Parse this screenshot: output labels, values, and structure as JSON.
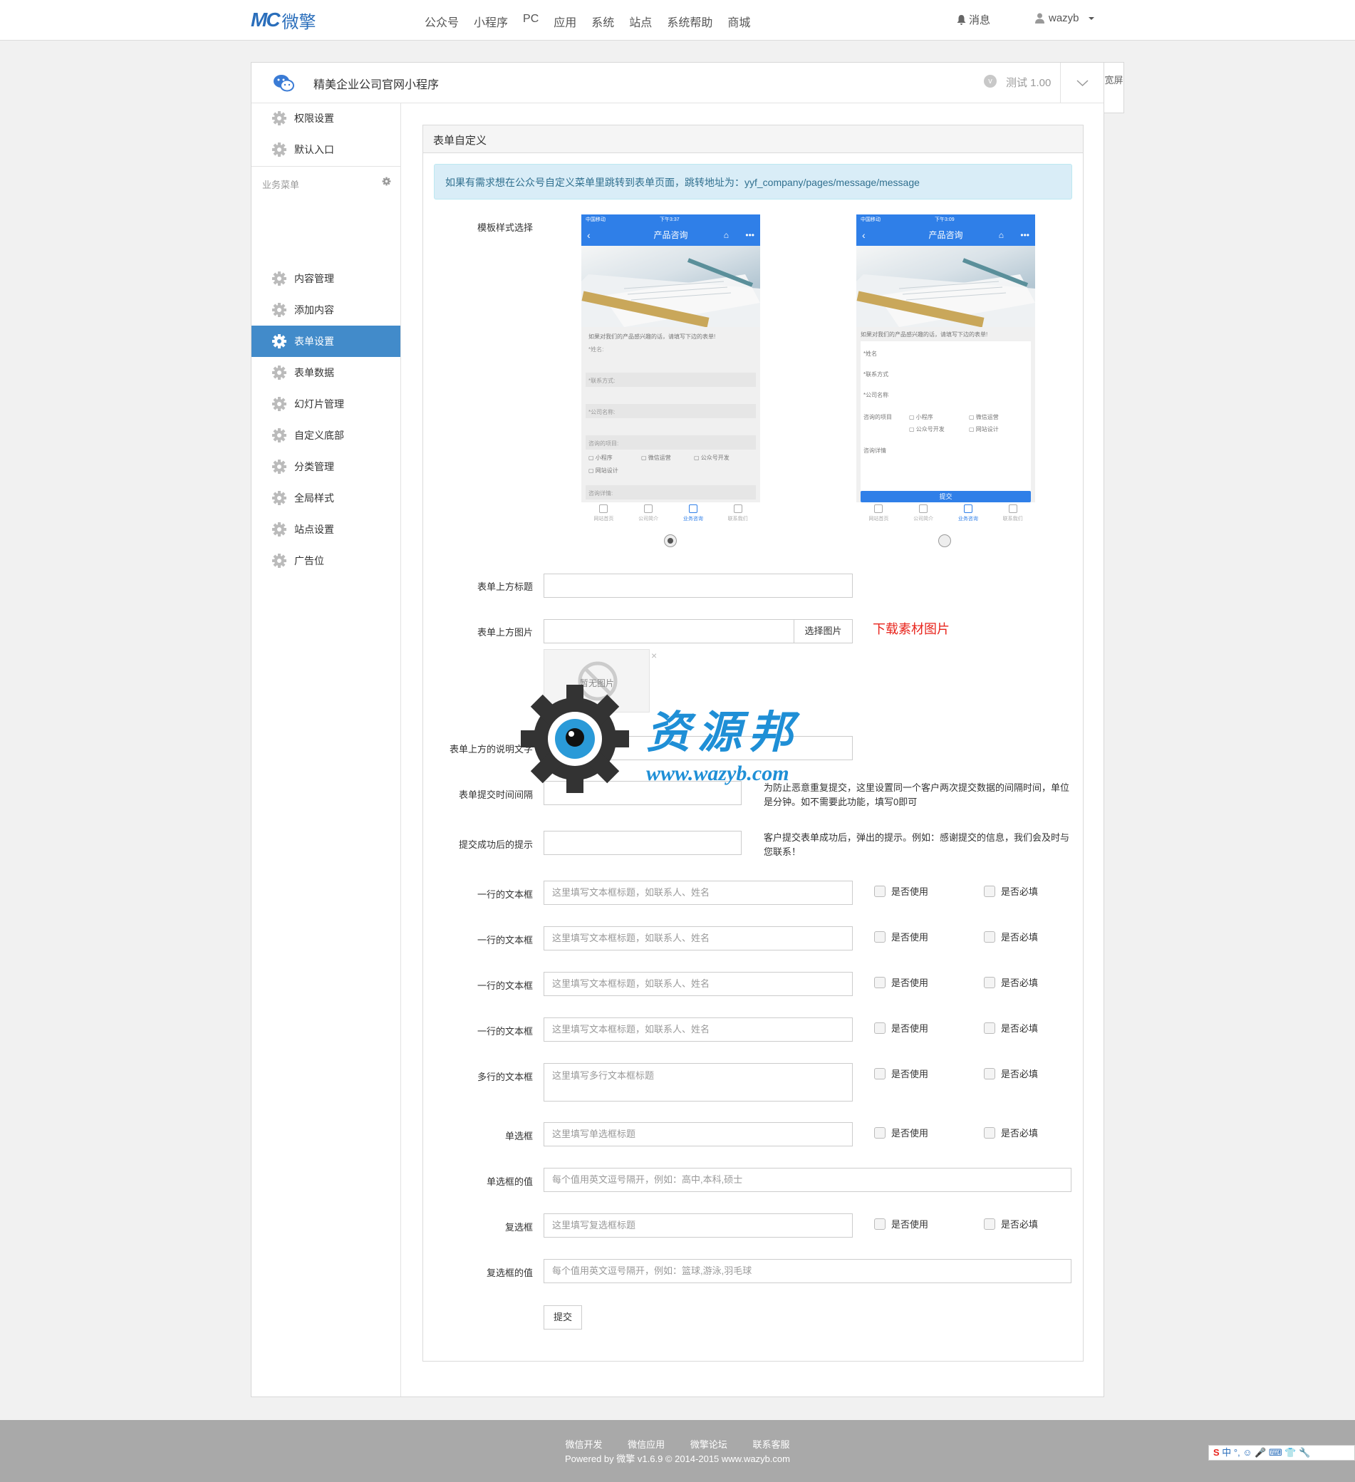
{
  "topbar": {
    "logo_mark": "MC",
    "logo_text": "微擎",
    "nav": [
      "公众号",
      "小程序",
      "PC",
      "应用",
      "系统",
      "站点",
      "系统帮助",
      "商城"
    ],
    "messages_label": "消息",
    "user_name": "wazyb"
  },
  "app": {
    "title": "精美企业公司官网小程序",
    "version": "测试 1.00",
    "wide_label": "宽屏"
  },
  "sidebar": {
    "top_items": [
      {
        "label": "权限设置"
      },
      {
        "label": "默认入口"
      }
    ],
    "group_title": "业务菜单",
    "items": [
      {
        "label": "内容管理"
      },
      {
        "label": "添加内容"
      },
      {
        "label": "表单设置",
        "active": true
      },
      {
        "label": "表单数据"
      },
      {
        "label": "幻灯片管理"
      },
      {
        "label": "自定义底部"
      },
      {
        "label": "分类管理"
      },
      {
        "label": "全局样式"
      },
      {
        "label": "站点设置"
      },
      {
        "label": "广告位"
      }
    ]
  },
  "card": {
    "title": "表单自定义",
    "notice": "如果有需求想在公众号自定义菜单里跳转到表单页面，跳转地址为：yyf_company/pages/message/message"
  },
  "templates": {
    "label": "模板样式选择",
    "selected_index": 0,
    "phone1": {
      "carrier": "中国移动",
      "time": "下午3:37",
      "bar_title": "产品咨询",
      "intro": "如果对我们的产品感兴趣的话，请填写下边的表单!",
      "fields": [
        "*姓名:",
        "*联系方式:",
        "*公司名称:",
        "咨询的项目:"
      ],
      "options": [
        "小程序",
        "微信运营",
        "公众号开发",
        "网站设计"
      ],
      "detail": "咨询详情:",
      "tabs": [
        "网站首页",
        "公司简介",
        "业务咨询",
        "联系我们"
      ]
    },
    "phone2": {
      "carrier": "中国移动",
      "time": "下午3:09",
      "bar_title": "产品咨询",
      "intro": "如果对我们的产品感兴趣的话，请填写下边的表单!",
      "fields": [
        "*姓名",
        "*联系方式",
        "*公司名称"
      ],
      "project_label": "咨询的项目",
      "options": [
        "小程序",
        "微信运营",
        "公众号开发",
        "网站设计"
      ],
      "detail": "咨询详情",
      "submit": "提交",
      "tabs": [
        "网站首页",
        "公司简介",
        "业务咨询",
        "联系我们"
      ]
    }
  },
  "form": {
    "top_title_label": "表单上方标题",
    "top_image_label": "表单上方图片",
    "choose_image_button": "选择图片",
    "download_link": "下载素材图片",
    "no_image_text": "暂无图片",
    "desc_label": "表单上方的说明文字",
    "interval_label": "表单提交时间间隔",
    "interval_hint": "为防止恶意重复提交，这里设置同一个客户两次提交数据的间隔时间，单位是分钟。如不需要此功能，填写0即可",
    "success_label": "提交成功后的提示",
    "success_hint": "客户提交表单成功后，弹出的提示。例如：感谢提交的信息，我们会及时与您联系！",
    "use_label": "是否使用",
    "required_label": "是否必填",
    "rows": [
      {
        "label": "一行的文本框",
        "placeholder": "这里填写文本框标题，如联系人、姓名"
      },
      {
        "label": "一行的文本框",
        "placeholder": "这里填写文本框标题，如联系人、姓名"
      },
      {
        "label": "一行的文本框",
        "placeholder": "这里填写文本框标题，如联系人、姓名"
      },
      {
        "label": "一行的文本框",
        "placeholder": "这里填写文本框标题，如联系人、姓名"
      }
    ],
    "multiline": {
      "label": "多行的文本框",
      "placeholder": "这里填写多行文本框标题"
    },
    "radio": {
      "label": "单选框",
      "placeholder": "这里填写单选框标题"
    },
    "radio_values": {
      "label": "单选框的值",
      "placeholder": "每个值用英文逗号隔开，例如：高中,本科,硕士"
    },
    "checkbox": {
      "label": "复选框",
      "placeholder": "这里填写复选框标题"
    },
    "checkbox_values": {
      "label": "复选框的值",
      "placeholder": "每个值用英文逗号隔开，例如：篮球,游泳,羽毛球"
    },
    "submit_button": "提交"
  },
  "watermark": {
    "title": "资源邦",
    "url": "www.wazyb.com"
  },
  "footer": {
    "links": [
      "微信开发",
      "微信应用",
      "微擎论坛",
      "联系客服"
    ],
    "copyright": "Powered by 微擎 v1.6.9 © 2014-2015 www.wazyb.com",
    "ime": "中 °, ☺ 🎤 ⌨ 👕 🔧"
  },
  "colors": {
    "accent": "#428bca",
    "brand": "#2a6ebb",
    "phone_blue": "#2f7fe8",
    "notice_bg": "#d9edf7",
    "link_red": "#e8251d",
    "footer_bg": "#a9a9a9"
  }
}
